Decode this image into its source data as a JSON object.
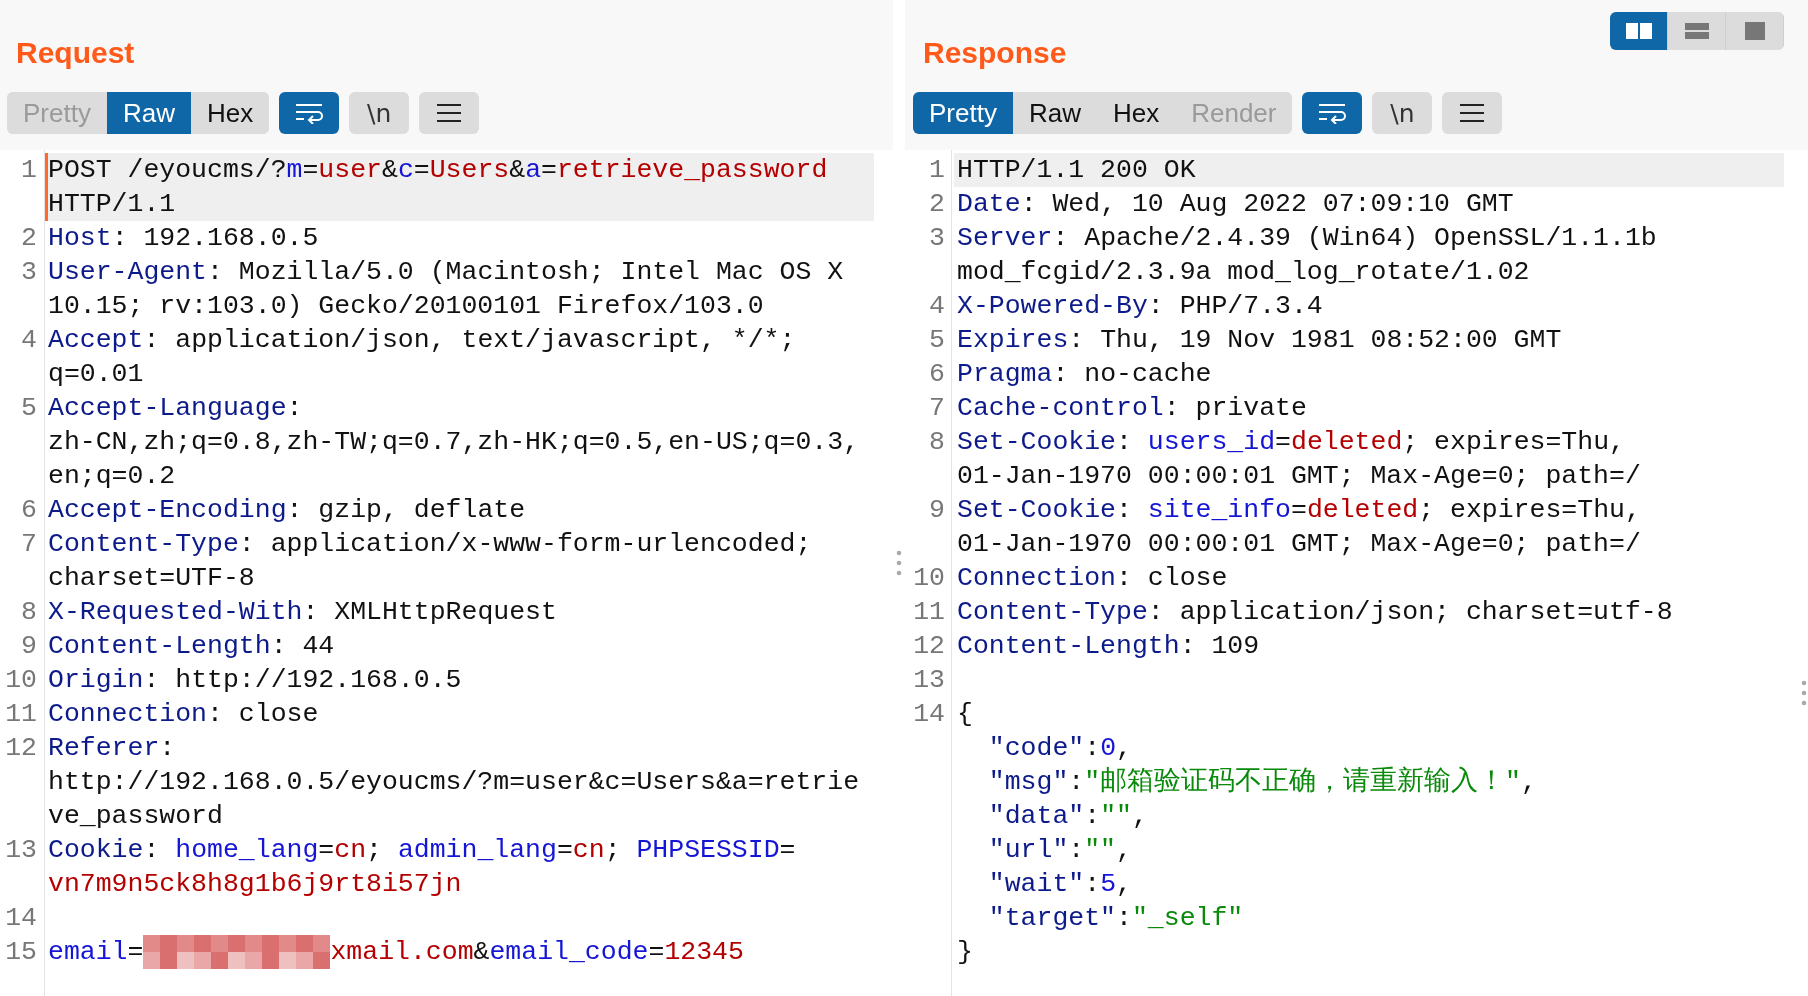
{
  "request": {
    "title": "Request",
    "view_tabs": [
      {
        "label": "Pretty",
        "selected": false,
        "disabled": true
      },
      {
        "label": "Raw",
        "selected": true,
        "disabled": false
      },
      {
        "label": "Hex",
        "selected": false,
        "disabled": false
      }
    ],
    "wrap_button": {
      "on": true
    },
    "newline_button": {
      "label": "\\n",
      "on": false
    },
    "lines": [
      {
        "number": "1",
        "highlighted": true,
        "cursor": true,
        "rows": [
          {
            "spans": [
              {
                "kind": "plain",
                "text": "POST /eyoucms/?"
              },
              {
                "kind": "param",
                "text": "m"
              },
              {
                "kind": "plain",
                "text": "="
              },
              {
                "kind": "value",
                "text": "user"
              },
              {
                "kind": "plain",
                "text": "&"
              },
              {
                "kind": "param",
                "text": "c"
              },
              {
                "kind": "plain",
                "text": "="
              },
              {
                "kind": "value",
                "text": "Users"
              },
              {
                "kind": "plain",
                "text": "&"
              },
              {
                "kind": "param",
                "text": "a"
              },
              {
                "kind": "plain",
                "text": "="
              },
              {
                "kind": "value",
                "text": "retrieve_password"
              }
            ]
          },
          {
            "spans": [
              {
                "kind": "plain",
                "text": "HTTP/1.1"
              }
            ]
          }
        ]
      },
      {
        "number": "2",
        "highlighted": false,
        "cursor": false,
        "rows": [
          {
            "spans": [
              {
                "kind": "name",
                "text": "Host"
              },
              {
                "kind": "plain",
                "text": ": 192.168.0.5"
              }
            ]
          }
        ]
      },
      {
        "number": "3",
        "highlighted": false,
        "cursor": false,
        "rows": [
          {
            "spans": [
              {
                "kind": "name",
                "text": "User-Agent"
              },
              {
                "kind": "plain",
                "text": ": Mozilla/5.0 (Macintosh; Intel Mac OS X"
              }
            ]
          },
          {
            "spans": [
              {
                "kind": "plain",
                "text": "10.15; rv:103.0) Gecko/20100101 Firefox/103.0"
              }
            ]
          }
        ]
      },
      {
        "number": "4",
        "highlighted": false,
        "cursor": false,
        "rows": [
          {
            "spans": [
              {
                "kind": "name",
                "text": "Accept"
              },
              {
                "kind": "plain",
                "text": ": application/json, text/javascript, */*;"
              }
            ]
          },
          {
            "spans": [
              {
                "kind": "plain",
                "text": "q=0.01"
              }
            ]
          }
        ]
      },
      {
        "number": "5",
        "highlighted": false,
        "cursor": false,
        "rows": [
          {
            "spans": [
              {
                "kind": "name",
                "text": "Accept-Language"
              },
              {
                "kind": "plain",
                "text": ":"
              }
            ]
          },
          {
            "spans": [
              {
                "kind": "plain",
                "text": "zh-CN,zh;q=0.8,zh-TW;q=0.7,zh-HK;q=0.5,en-US;q=0.3,"
              }
            ]
          },
          {
            "spans": [
              {
                "kind": "plain",
                "text": "en;q=0.2"
              }
            ]
          }
        ]
      },
      {
        "number": "6",
        "highlighted": false,
        "cursor": false,
        "rows": [
          {
            "spans": [
              {
                "kind": "name",
                "text": "Accept-Encoding"
              },
              {
                "kind": "plain",
                "text": ": gzip, deflate"
              }
            ]
          }
        ]
      },
      {
        "number": "7",
        "highlighted": false,
        "cursor": false,
        "rows": [
          {
            "spans": [
              {
                "kind": "name",
                "text": "Content-Type"
              },
              {
                "kind": "plain",
                "text": ": application/x-www-form-urlencoded;"
              }
            ]
          },
          {
            "spans": [
              {
                "kind": "plain",
                "text": "charset=UTF-8"
              }
            ]
          }
        ]
      },
      {
        "number": "8",
        "highlighted": false,
        "cursor": false,
        "rows": [
          {
            "spans": [
              {
                "kind": "name",
                "text": "X-Requested-With"
              },
              {
                "kind": "plain",
                "text": ": XMLHttpRequest"
              }
            ]
          }
        ]
      },
      {
        "number": "9",
        "highlighted": false,
        "cursor": false,
        "rows": [
          {
            "spans": [
              {
                "kind": "name",
                "text": "Content-Length"
              },
              {
                "kind": "plain",
                "text": ": 44"
              }
            ]
          }
        ]
      },
      {
        "number": "10",
        "highlighted": false,
        "cursor": false,
        "rows": [
          {
            "spans": [
              {
                "kind": "name",
                "text": "Origin"
              },
              {
                "kind": "plain",
                "text": ": http://192.168.0.5"
              }
            ]
          }
        ]
      },
      {
        "number": "11",
        "highlighted": false,
        "cursor": false,
        "rows": [
          {
            "spans": [
              {
                "kind": "name",
                "text": "Connection"
              },
              {
                "kind": "plain",
                "text": ": close"
              }
            ]
          }
        ]
      },
      {
        "number": "12",
        "highlighted": false,
        "cursor": false,
        "rows": [
          {
            "spans": [
              {
                "kind": "name",
                "text": "Referer"
              },
              {
                "kind": "plain",
                "text": ":"
              }
            ]
          },
          {
            "spans": [
              {
                "kind": "plain",
                "text": "http://192.168.0.5/eyoucms/?m=user&c=Users&a=retrie"
              }
            ]
          },
          {
            "spans": [
              {
                "kind": "plain",
                "text": "ve_password"
              }
            ]
          }
        ]
      },
      {
        "number": "13",
        "highlighted": false,
        "cursor": false,
        "rows": [
          {
            "spans": [
              {
                "kind": "name",
                "text": "Cookie"
              },
              {
                "kind": "plain",
                "text": ": "
              },
              {
                "kind": "param",
                "text": "home_lang"
              },
              {
                "kind": "plain",
                "text": "="
              },
              {
                "kind": "value",
                "text": "cn"
              },
              {
                "kind": "plain",
                "text": "; "
              },
              {
                "kind": "param",
                "text": "admin_lang"
              },
              {
                "kind": "plain",
                "text": "="
              },
              {
                "kind": "value",
                "text": "cn"
              },
              {
                "kind": "plain",
                "text": "; "
              },
              {
                "kind": "param",
                "text": "PHPSESSID"
              },
              {
                "kind": "plain",
                "text": "="
              }
            ]
          },
          {
            "spans": [
              {
                "kind": "value",
                "text": "vn7m9n5ck8h8g1b6j9rt8i57jn"
              }
            ]
          }
        ]
      },
      {
        "number": "14",
        "highlighted": false,
        "cursor": false
      },
      {
        "number": "15",
        "highlighted": false,
        "cursor": false,
        "rows": [
          {
            "spans": [
              {
                "kind": "param",
                "text": "email"
              },
              {
                "kind": "plain",
                "text": "="
              },
              {
                "kind": "redacted"
              },
              {
                "kind": "value",
                "text": "xmail.com"
              },
              {
                "kind": "plain",
                "text": "&"
              },
              {
                "kind": "param",
                "text": "email_code"
              },
              {
                "kind": "plain",
                "text": "="
              },
              {
                "kind": "value",
                "text": "12345"
              }
            ]
          }
        ]
      }
    ]
  },
  "response": {
    "title": "Response",
    "layout_buttons": [
      {
        "kind": "split",
        "selected": true
      },
      {
        "kind": "stacked",
        "selected": false
      },
      {
        "kind": "single",
        "selected": false
      }
    ],
    "view_tabs": [
      {
        "label": "Pretty",
        "selected": true,
        "disabled": false
      },
      {
        "label": "Raw",
        "selected": false,
        "disabled": false
      },
      {
        "label": "Hex",
        "selected": false,
        "disabled": false
      },
      {
        "label": "Render",
        "selected": false,
        "disabled": true
      }
    ],
    "wrap_button": {
      "on": true
    },
    "newline_button": {
      "label": "\\n",
      "on": false
    },
    "lines": [
      {
        "number": "1",
        "highlighted": true,
        "cursor": false,
        "rows": [
          {
            "spans": [
              {
                "kind": "plain",
                "text": "HTTP/1.1 200 OK"
              }
            ]
          }
        ]
      },
      {
        "number": "2",
        "highlighted": false,
        "cursor": false,
        "rows": [
          {
            "spans": [
              {
                "kind": "name",
                "text": "Date"
              },
              {
                "kind": "plain",
                "text": ": Wed, 10 Aug 2022 07:09:10 GMT"
              }
            ]
          }
        ]
      },
      {
        "number": "3",
        "highlighted": false,
        "cursor": false,
        "rows": [
          {
            "spans": [
              {
                "kind": "name",
                "text": "Server"
              },
              {
                "kind": "plain",
                "text": ": Apache/2.4.39 (Win64) OpenSSL/1.1.1b"
              }
            ]
          },
          {
            "spans": [
              {
                "kind": "plain",
                "text": "mod_fcgid/2.3.9a mod_log_rotate/1.02"
              }
            ]
          }
        ]
      },
      {
        "number": "4",
        "highlighted": false,
        "cursor": false,
        "rows": [
          {
            "spans": [
              {
                "kind": "name",
                "text": "X-Powered-By"
              },
              {
                "kind": "plain",
                "text": ": PHP/7.3.4"
              }
            ]
          }
        ]
      },
      {
        "number": "5",
        "highlighted": false,
        "cursor": false,
        "rows": [
          {
            "spans": [
              {
                "kind": "name",
                "text": "Expires"
              },
              {
                "kind": "plain",
                "text": ": Thu, 19 Nov 1981 08:52:00 GMT"
              }
            ]
          }
        ]
      },
      {
        "number": "6",
        "highlighted": false,
        "cursor": false,
        "rows": [
          {
            "spans": [
              {
                "kind": "name",
                "text": "Pragma"
              },
              {
                "kind": "plain",
                "text": ": no-cache"
              }
            ]
          }
        ]
      },
      {
        "number": "7",
        "highlighted": false,
        "cursor": false,
        "rows": [
          {
            "spans": [
              {
                "kind": "name",
                "text": "Cache-control"
              },
              {
                "kind": "plain",
                "text": ": private"
              }
            ]
          }
        ]
      },
      {
        "number": "8",
        "highlighted": false,
        "cursor": false,
        "rows": [
          {
            "spans": [
              {
                "kind": "name",
                "text": "Set-Cookie"
              },
              {
                "kind": "plain",
                "text": ": "
              },
              {
                "kind": "param",
                "text": "users_id"
              },
              {
                "kind": "plain",
                "text": "="
              },
              {
                "kind": "value",
                "text": "deleted"
              },
              {
                "kind": "plain",
                "text": "; expires=Thu,"
              }
            ]
          },
          {
            "spans": [
              {
                "kind": "plain",
                "text": "01-Jan-1970 00:00:01 GMT; Max-Age=0; path=/"
              }
            ]
          }
        ]
      },
      {
        "number": "9",
        "highlighted": false,
        "cursor": false,
        "rows": [
          {
            "spans": [
              {
                "kind": "name",
                "text": "Set-Cookie"
              },
              {
                "kind": "plain",
                "text": ": "
              },
              {
                "kind": "param",
                "text": "site_info"
              },
              {
                "kind": "plain",
                "text": "="
              },
              {
                "kind": "value",
                "text": "deleted"
              },
              {
                "kind": "plain",
                "text": "; expires=Thu,"
              }
            ]
          },
          {
            "spans": [
              {
                "kind": "plain",
                "text": "01-Jan-1970 00:00:01 GMT; Max-Age=0; path=/"
              }
            ]
          }
        ]
      },
      {
        "number": "10",
        "highlighted": false,
        "cursor": false,
        "rows": [
          {
            "spans": [
              {
                "kind": "name",
                "text": "Connection"
              },
              {
                "kind": "plain",
                "text": ": close"
              }
            ]
          }
        ]
      },
      {
        "number": "11",
        "highlighted": false,
        "cursor": false,
        "rows": [
          {
            "spans": [
              {
                "kind": "name",
                "text": "Content-Type"
              },
              {
                "kind": "plain",
                "text": ": application/json; charset=utf-8"
              }
            ]
          }
        ]
      },
      {
        "number": "12",
        "highlighted": false,
        "cursor": false,
        "rows": [
          {
            "spans": [
              {
                "kind": "name",
                "text": "Content-Length"
              },
              {
                "kind": "plain",
                "text": ": 109"
              }
            ]
          }
        ]
      },
      {
        "number": "13",
        "highlighted": false,
        "cursor": false
      },
      {
        "number": "14",
        "highlighted": false,
        "cursor": false,
        "rows": [
          {
            "indented": false,
            "spans": [
              {
                "kind": "plain",
                "text": "{"
              }
            ]
          },
          {
            "indented": true,
            "spans": [
              {
                "kind": "key",
                "text": "\"code\""
              },
              {
                "kind": "plain",
                "text": ":"
              },
              {
                "kind": "number",
                "text": "0"
              },
              {
                "kind": "plain",
                "text": ","
              }
            ]
          },
          {
            "indented": true,
            "spans": [
              {
                "kind": "key",
                "text": "\"msg\""
              },
              {
                "kind": "plain",
                "text": ":"
              },
              {
                "kind": "string",
                "text": "\"邮箱验证码不正确，请重新输入！\""
              },
              {
                "kind": "plain",
                "text": ","
              }
            ]
          },
          {
            "indented": true,
            "spans": [
              {
                "kind": "key",
                "text": "\"data\""
              },
              {
                "kind": "plain",
                "text": ":"
              },
              {
                "kind": "string",
                "text": "\"\""
              },
              {
                "kind": "plain",
                "text": ","
              }
            ]
          },
          {
            "indented": true,
            "spans": [
              {
                "kind": "key",
                "text": "\"url\""
              },
              {
                "kind": "plain",
                "text": ":"
              },
              {
                "kind": "string",
                "text": "\"\""
              },
              {
                "kind": "plain",
                "text": ","
              }
            ]
          },
          {
            "indented": true,
            "spans": [
              {
                "kind": "key",
                "text": "\"wait\""
              },
              {
                "kind": "plain",
                "text": ":"
              },
              {
                "kind": "number",
                "text": "5"
              },
              {
                "kind": "plain",
                "text": ","
              }
            ]
          },
          {
            "indented": true,
            "spans": [
              {
                "kind": "key",
                "text": "\"target\""
              },
              {
                "kind": "plain",
                "text": ":"
              },
              {
                "kind": "string",
                "text": "\"_self\""
              }
            ]
          },
          {
            "indented": false,
            "spans": [
              {
                "kind": "plain",
                "text": "}"
              }
            ]
          }
        ]
      }
    ]
  }
}
